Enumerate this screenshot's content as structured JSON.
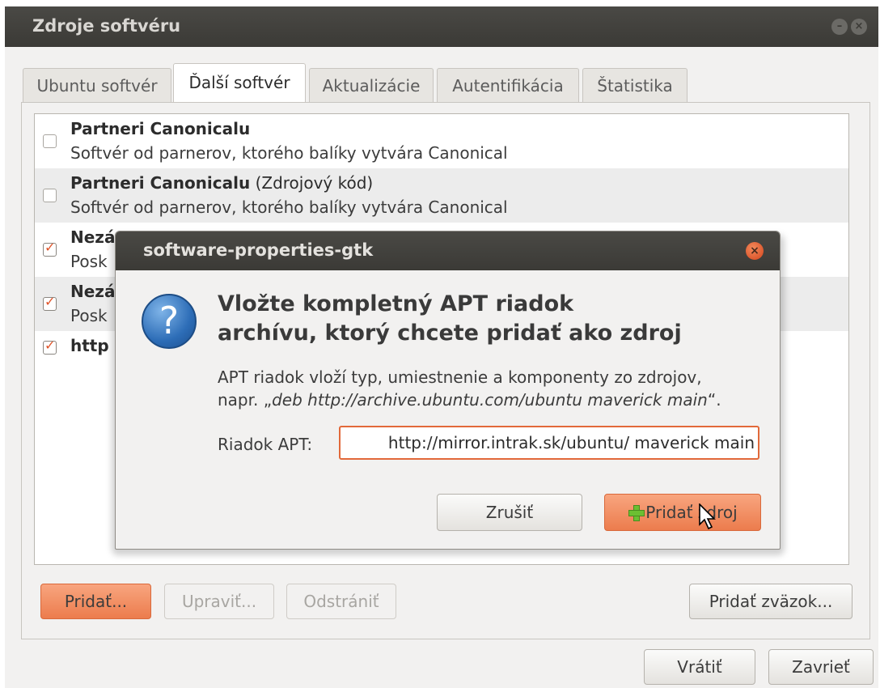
{
  "window": {
    "title": "Zdroje softvéru",
    "tabs": [
      {
        "label": "Ubuntu softvér",
        "active": false
      },
      {
        "label": "Ďalší softvér",
        "active": true
      },
      {
        "label": "Aktualizácie",
        "active": false
      },
      {
        "label": "Autentifikácia",
        "active": false
      },
      {
        "label": "Štatistika",
        "active": false
      }
    ]
  },
  "sources": [
    {
      "title": "Partneri Canonicalu",
      "suffix": "",
      "description": "Softvér od parnerov, ktorého balíky vytvára Canonical",
      "checked": false
    },
    {
      "title": "Partneri Canonicalu",
      "suffix": " (Zdrojový kód)",
      "description": "Softvér od parnerov, ktorého balíky vytvára Canonical",
      "checked": false
    },
    {
      "title": "Nezá",
      "suffix": "",
      "description": "Posk",
      "checked": true
    },
    {
      "title": "Nezá",
      "suffix": "",
      "description": "Posk",
      "checked": true
    },
    {
      "title": "http",
      "suffix": "",
      "description": "",
      "checked": true
    }
  ],
  "list_buttons": {
    "add": "Pridať...",
    "edit": "Upraviť...",
    "remove": "Odstrániť",
    "add_key": "Pridať zväzok..."
  },
  "footer_buttons": {
    "revert": "Vrátiť",
    "close": "Zavrieť"
  },
  "dialog": {
    "title": "software-properties-gtk",
    "heading_line1": "Vložte kompletný APT riadok",
    "heading_line2": "archívu, ktorý chcete pridať ako zdroj",
    "body_line1": "APT riadok vloží typ, umiestnenie a komponenty zo zdrojov,",
    "body_line2_prefix": "napr. „",
    "body_line2_example": "deb http://archive.ubuntu.com/ubuntu maverick main",
    "body_line2_suffix": "“.",
    "apt_label": "Riadok APT:",
    "apt_value": "http://mirror.intrak.sk/ubuntu/ maverick main",
    "cancel_label": "Zrušiť",
    "add_source_label": "Pridať zdroj"
  },
  "colors": {
    "accent_orange": "#ec7c4d",
    "titlebar": "#3b3a36",
    "check_orange": "#e0542a"
  }
}
